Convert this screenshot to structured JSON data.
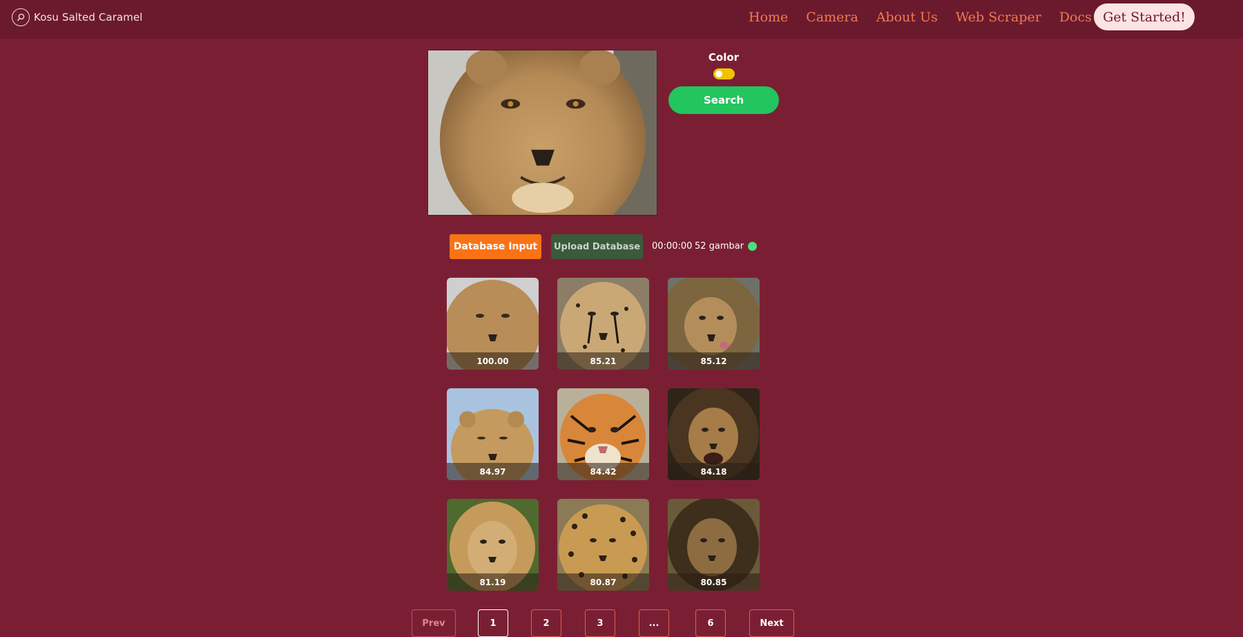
{
  "brand": {
    "name": "Kosu Salted Caramel",
    "icon": "lollipop-icon"
  },
  "nav": {
    "links": [
      "Home",
      "Camera",
      "About Us",
      "Web Scraper",
      "Docs"
    ],
    "cta": "Get Started!"
  },
  "controls": {
    "color_label": "Color",
    "color_toggle_on": true,
    "search_label": "Search"
  },
  "database": {
    "input_label": "Database Input",
    "upload_label": "Upload Database",
    "timer": "00:00:00",
    "count": "52 gambar",
    "status_color": "#4ade80"
  },
  "results": [
    {
      "score": "100.00",
      "animal": "lioness"
    },
    {
      "score": "85.21",
      "animal": "cheetah"
    },
    {
      "score": "85.12",
      "animal": "lion"
    },
    {
      "score": "84.97",
      "animal": "lioness"
    },
    {
      "score": "84.42",
      "animal": "tiger"
    },
    {
      "score": "84.18",
      "animal": "lion"
    },
    {
      "score": "81.19",
      "animal": "lion"
    },
    {
      "score": "80.87",
      "animal": "leopard"
    },
    {
      "score": "80.85",
      "animal": "lion"
    }
  ],
  "pagination": {
    "prev": "Prev",
    "pages": [
      "1",
      "2",
      "3",
      "...",
      "6"
    ],
    "current": "1",
    "next": "Next"
  },
  "colors": {
    "background": "#7a1f33",
    "navbar": "#6b1a2d",
    "nav_link": "#f07a56",
    "search": "#22c55e",
    "db_input": "#f97316",
    "upload": "#3a5a3a"
  }
}
